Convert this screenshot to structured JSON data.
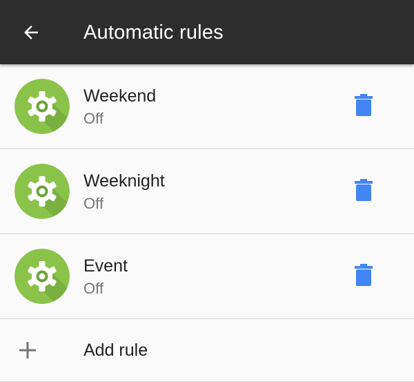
{
  "toolbar": {
    "title": "Automatic rules",
    "back_icon": "arrow-back-icon",
    "background": "#2d2d2d"
  },
  "rules": [
    {
      "name": "Weekend",
      "status": "Off",
      "icon": "gear-icon",
      "delete_icon": "trash-icon"
    },
    {
      "name": "Weeknight",
      "status": "Off",
      "icon": "gear-icon",
      "delete_icon": "trash-icon"
    },
    {
      "name": "Event",
      "status": "Off",
      "icon": "gear-icon",
      "delete_icon": "trash-icon"
    }
  ],
  "add_rule": {
    "label": "Add rule",
    "icon": "plus-icon"
  },
  "colors": {
    "rule_icon_green": "#8bc34a",
    "delete_blue": "#4285f4"
  }
}
